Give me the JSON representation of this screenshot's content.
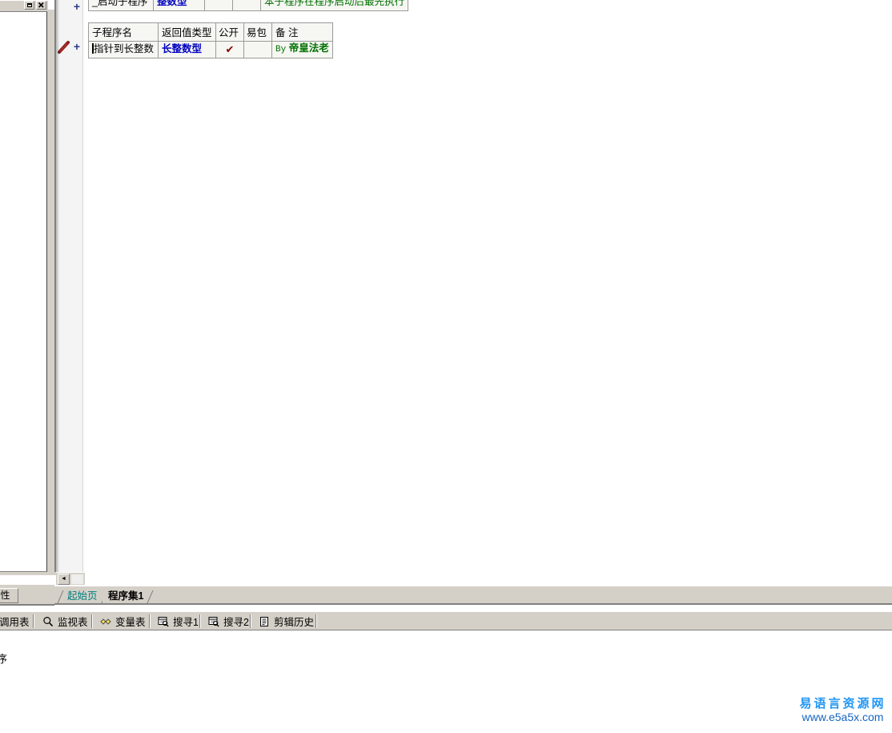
{
  "window": {
    "maximize_label": "□",
    "close_label": "✕"
  },
  "left_panel": {
    "property_tab_label": "属性"
  },
  "gutter": {
    "pencil_icon": "pencil-icon",
    "expand_marker": "+"
  },
  "code": {
    "startup_row": {
      "name": "_启动子程序",
      "return_type": "整数型",
      "public": "",
      "package": "",
      "remark": "本子程序在程序启动后最先执行"
    },
    "sub_table": {
      "headers": {
        "name": "子程序名",
        "return_type": "返回值类型",
        "public": "公开",
        "package": "易包",
        "remark": "备 注"
      },
      "rows": [
        {
          "name": "指针到长整数",
          "return_type": "长整数型",
          "public": "✔",
          "package": "",
          "remark_prefix": "By",
          "remark_author": "帝皇法老"
        }
      ]
    }
  },
  "hscroll": {
    "left_arrow": "◄"
  },
  "doc_tabs": [
    {
      "label": "起始页",
      "active": false
    },
    {
      "label": "程序集1",
      "active": true
    }
  ],
  "tool_tabs": [
    {
      "label": "调用表",
      "icon": ""
    },
    {
      "label": "监视表",
      "icon": "magnifier-icon"
    },
    {
      "label": "变量表",
      "icon": "diamonds-icon"
    },
    {
      "label": "搜寻1",
      "icon": "find-window-icon"
    },
    {
      "label": "搜寻2",
      "icon": "find-window-icon"
    },
    {
      "label": "剪辑历史",
      "icon": "clipboard-icon"
    }
  ],
  "output": {
    "text": "序"
  },
  "watermark": {
    "cn": "易语言资源网",
    "url": "www.e5a5x.com"
  },
  "colors": {
    "chrome": "#d4d0c8",
    "code_type": "#0000c0",
    "code_remark": "#007000",
    "check_mark": "#800000",
    "tab_inactive_text": "#008080",
    "watermark_cn": "#2196f3",
    "watermark_url": "#1565c0"
  }
}
